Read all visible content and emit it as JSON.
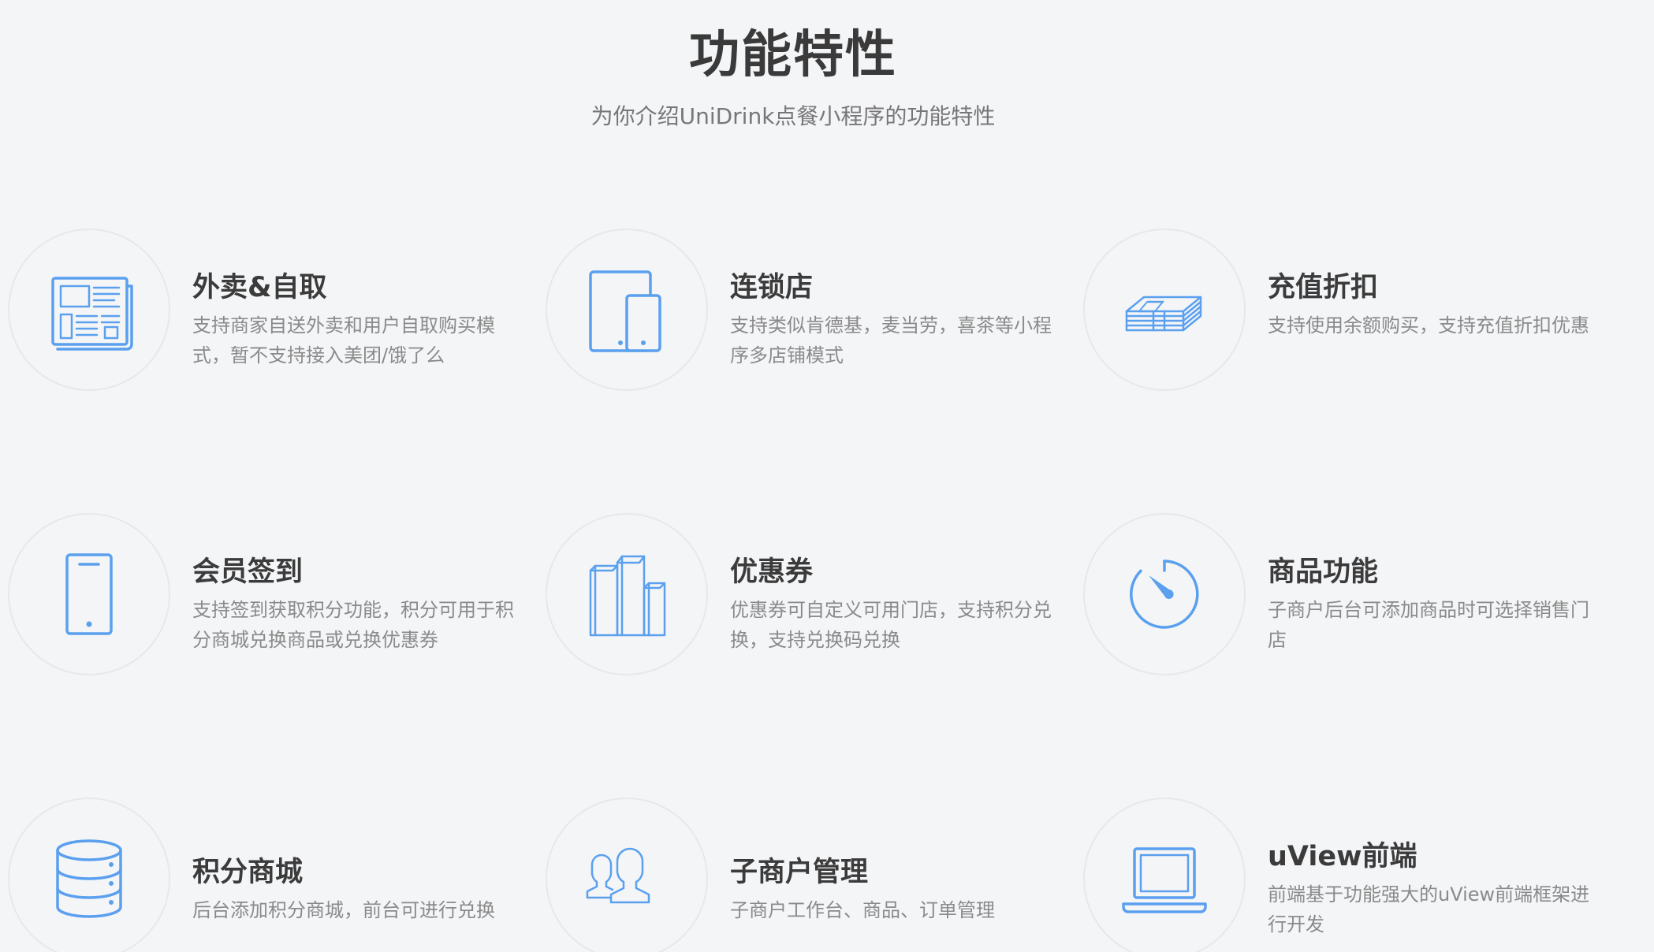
{
  "header": {
    "title": "功能特性",
    "subtitle": "为你介绍UniDrink点餐小程序的功能特性"
  },
  "features": [
    {
      "icon": "newspaper-icon",
      "title": "外卖&自取",
      "desc": "支持商家自送外卖和用户自取购买模式，暂不支持接入美团/饿了么"
    },
    {
      "icon": "devices-icon",
      "title": "连锁店",
      "desc": "支持类似肯德基，麦当劳，喜茶等小程序多店铺模式"
    },
    {
      "icon": "money-stack-icon",
      "title": "充值折扣",
      "desc": "支持使用余额购买，支持充值折扣优惠"
    },
    {
      "icon": "mobile-phone-icon",
      "title": "会员签到",
      "desc": "支持签到获取积分功能，积分可用于积分商城兑换商品或兑换优惠券"
    },
    {
      "icon": "buildings-icon",
      "title": "优惠券",
      "desc": "优惠券可自定义可用门店，支持积分兑换，支持兑换码兑换"
    },
    {
      "icon": "timer-icon",
      "title": "商品功能",
      "desc": "子商户后台可添加商品时可选择销售门店"
    },
    {
      "icon": "database-icon",
      "title": "积分商城",
      "desc": "后台添加积分商城，前台可进行兑换"
    },
    {
      "icon": "users-icon",
      "title": "子商户管理",
      "desc": "子商户工作台、商品、订单管理"
    },
    {
      "icon": "laptop-icon",
      "title": "uView前端",
      "desc": "前端基于功能强大的uView前端框架进行开发"
    }
  ],
  "colors": {
    "accent": "#5aa0ef",
    "background": "#f4f5f7",
    "title": "#3b3b3b",
    "text": "#8a8a8a"
  }
}
